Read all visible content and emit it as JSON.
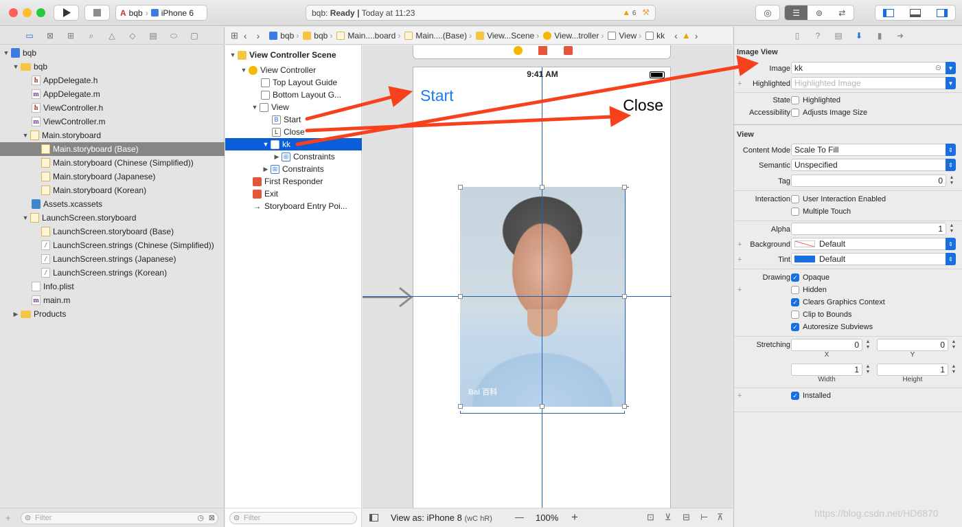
{
  "toolbar": {
    "scheme_project": "bqb",
    "scheme_device": "iPhone 6",
    "activity_project": "bqb:",
    "activity_status": "Ready",
    "activity_sep": "|",
    "activity_time": "Today at 11:23",
    "warning_count": "6"
  },
  "navigator": {
    "filter_placeholder": "Filter",
    "items": [
      {
        "label": "bqb",
        "icon": "project-icon"
      },
      {
        "label": "bqb",
        "icon": "folder-icon"
      },
      {
        "label": "AppDelegate.h",
        "icon": "header-file-icon"
      },
      {
        "label": "AppDelegate.m",
        "icon": "objc-file-icon"
      },
      {
        "label": "ViewController.h",
        "icon": "header-file-icon"
      },
      {
        "label": "ViewController.m",
        "icon": "objc-file-icon"
      },
      {
        "label": "Main.storyboard",
        "icon": "storyboard-icon"
      },
      {
        "label": "Main.storyboard (Base)",
        "icon": "storyboard-icon"
      },
      {
        "label": "Main.storyboard (Chinese (Simplified))",
        "icon": "storyboard-icon"
      },
      {
        "label": "Main.storyboard (Japanese)",
        "icon": "storyboard-icon"
      },
      {
        "label": "Main.storyboard (Korean)",
        "icon": "storyboard-icon"
      },
      {
        "label": "Assets.xcassets",
        "icon": "assets-icon"
      },
      {
        "label": "LaunchScreen.storyboard",
        "icon": "storyboard-icon"
      },
      {
        "label": "LaunchScreen.storyboard (Base)",
        "icon": "storyboard-icon"
      },
      {
        "label": "LaunchScreen.strings (Chinese (Simplified))",
        "icon": "strings-file-icon"
      },
      {
        "label": "LaunchScreen.strings (Japanese)",
        "icon": "strings-file-icon"
      },
      {
        "label": "LaunchScreen.strings (Korean)",
        "icon": "strings-file-icon"
      },
      {
        "label": "Info.plist",
        "icon": "plist-file-icon"
      },
      {
        "label": "main.m",
        "icon": "objc-file-icon"
      },
      {
        "label": "Products",
        "icon": "folder-icon"
      }
    ]
  },
  "jumpbar": [
    "bqb",
    "bqb",
    "Main....board",
    "Main....(Base)",
    "View...Scene",
    "View...troller",
    "View",
    "kk"
  ],
  "outline": {
    "filter_placeholder": "Filter",
    "items": [
      {
        "label": "View Controller Scene"
      },
      {
        "label": "View Controller"
      },
      {
        "label": "Top Layout Guide"
      },
      {
        "label": "Bottom Layout G..."
      },
      {
        "label": "View"
      },
      {
        "label": "Start",
        "badge": "B"
      },
      {
        "label": "Close",
        "badge": "L"
      },
      {
        "label": "kk"
      },
      {
        "label": "Constraints"
      },
      {
        "label": "Constraints"
      },
      {
        "label": "First Responder"
      },
      {
        "label": "Exit"
      },
      {
        "label": "Storyboard Entry Poi..."
      }
    ]
  },
  "canvas": {
    "time": "9:41 AM",
    "start_label": "Start",
    "close_label": "Close",
    "watermark_photo": "Bai 百科",
    "view_as": "View as: iPhone 8",
    "size_class": "(wC hR)",
    "zoom_minus": "—",
    "zoom": "100%",
    "zoom_plus": "+"
  },
  "inspector": {
    "image_view": {
      "title": "Image View",
      "image_label": "Image",
      "image_value": "kk",
      "highlighted_label": "Highlighted",
      "highlighted_placeholder": "Highlighted Image",
      "state_label": "State",
      "state_option": "Highlighted",
      "accessibility_label": "Accessibility",
      "accessibility_option": "Adjusts Image Size"
    },
    "view": {
      "title": "View",
      "content_mode_label": "Content Mode",
      "content_mode": "Scale To Fill",
      "semantic_label": "Semantic",
      "semantic": "Unspecified",
      "tag_label": "Tag",
      "tag": "0",
      "interaction_label": "Interaction",
      "user_interaction": "User Interaction Enabled",
      "multiple_touch": "Multiple Touch",
      "alpha_label": "Alpha",
      "alpha": "1",
      "background_label": "Background",
      "background": "Default",
      "tint_label": "Tint",
      "tint": "Default",
      "tint_color": "#1a6fe0",
      "drawing_label": "Drawing",
      "opaque": "Opaque",
      "hidden": "Hidden",
      "clears_context": "Clears Graphics Context",
      "clip_bounds": "Clip to Bounds",
      "autoresize": "Autoresize Subviews",
      "stretching_label": "Stretching",
      "stretch_x": "0",
      "stretch_y": "0",
      "x_label": "X",
      "y_label": "Y",
      "stretch_w": "1",
      "stretch_h": "1",
      "width_label": "Width",
      "height_label": "Height",
      "installed": "Installed"
    }
  },
  "watermark": "https://blog.csdn.net/HD6870",
  "colors": {
    "accent": "#1a6fe0",
    "selection": "#0a5fd8",
    "annotation_arrow": "#f7411d"
  }
}
